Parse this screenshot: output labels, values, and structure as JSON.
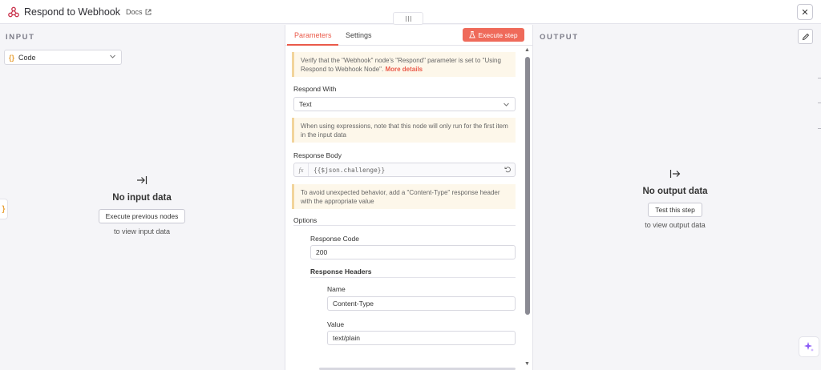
{
  "header": {
    "title": "Respond to Webhook",
    "docs_label": "Docs",
    "close_symbol": "✕"
  },
  "input_panel": {
    "heading": "INPUT",
    "source_select": {
      "value": "Code",
      "icon": "braces-icon",
      "icon_text": "{}"
    },
    "empty_title": "No input data",
    "execute_button": "Execute previous nodes",
    "empty_sub": "to view input data",
    "side_tab_text": "}"
  },
  "params_panel": {
    "tabs": [
      {
        "label": "Parameters",
        "active": true
      },
      {
        "label": "Settings",
        "active": false
      }
    ],
    "execute_button": "Execute step",
    "notice_webhook": {
      "text": "Verify that the \"Webhook\" node's \"Respond\" parameter is set to \"Using Respond to Webhook Node\".",
      "link": "More details"
    },
    "respond_with": {
      "label": "Respond With",
      "value": "Text"
    },
    "notice_expressions": "When using expressions, note that this node will only run for the first item in the input data",
    "response_body": {
      "label": "Response Body",
      "fx": "fx",
      "value": "{{$json.challenge}}"
    },
    "notice_content_type": "To avoid unexpected behavior, add a \"Content-Type\" response header with the appropriate value",
    "options_label": "Options",
    "response_code": {
      "label": "Response Code",
      "value": "200"
    },
    "response_headers": {
      "label": "Response Headers",
      "name_label": "Name",
      "name_value": "Content-Type",
      "value_label": "Value",
      "value_value": "text/plain"
    }
  },
  "output_panel": {
    "heading": "OUTPUT",
    "empty_title": "No output data",
    "test_button": "Test this step",
    "empty_sub": "to view output data"
  },
  "colors": {
    "accent": "#ea5a4a",
    "execute_button": "#ef6a5a",
    "notice_bg": "#fdf7ea",
    "notice_border": "#f2d49b",
    "code_icon": "#e8a23a",
    "ai_icon": "#8b5cf6"
  }
}
